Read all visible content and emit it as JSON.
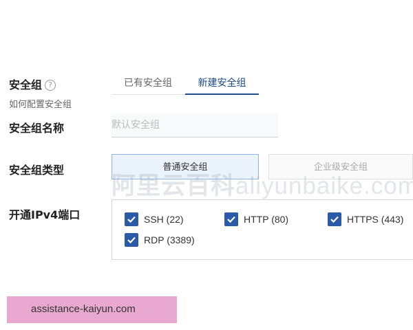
{
  "security_group": {
    "label": "安全组",
    "help_icon": "?",
    "how_to_config": "如何配置安全组",
    "tabs": [
      {
        "label": "已有安全组",
        "active": false
      },
      {
        "label": "新建安全组",
        "active": true
      }
    ]
  },
  "group_name": {
    "label": "安全组名称",
    "placeholder": "默认安全组",
    "value": ""
  },
  "group_type": {
    "label": "安全组类型",
    "options": [
      {
        "label": "普通安全组",
        "selected": true
      },
      {
        "label": "企业级安全组",
        "selected": false
      }
    ]
  },
  "open_ports": {
    "label": "开通IPv4端口",
    "ports": [
      {
        "label": "SSH (22)",
        "checked": true
      },
      {
        "label": "HTTP (80)",
        "checked": true
      },
      {
        "label": "HTTPS (443)",
        "checked": true
      },
      {
        "label": "RDP (3389)",
        "checked": true
      }
    ]
  },
  "watermark": {
    "cn": "阿里云百科",
    "en": "aliyunbaike.com"
  },
  "footer": {
    "text": "assistance-kaiyun.com"
  },
  "colors": {
    "accent": "#1a4a8a",
    "checkbox": "#2b5aa8",
    "selected_bg": "#eaf2fb",
    "banner": "#e8a8cf"
  }
}
